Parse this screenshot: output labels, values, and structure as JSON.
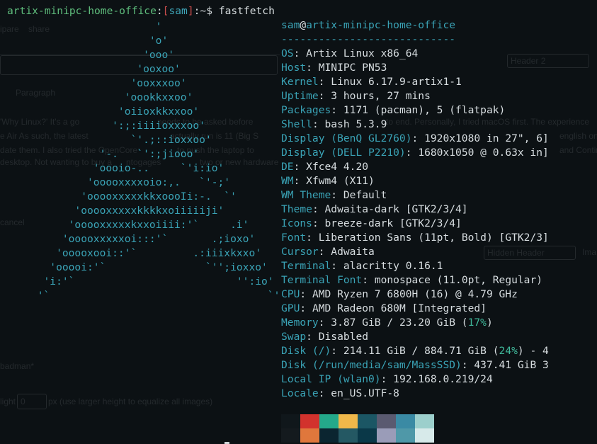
{
  "prompt": {
    "host": "artix-minipc-home-office",
    "colon": ":",
    "user": "sam",
    "suffix": ":~$ ",
    "command": "fastfetch"
  },
  "logo_lines": [
    "                         '",
    "                        'o'",
    "                       'ooo'",
    "                      'ooxoo'",
    "                     'ooxxxoo'",
    "                    'oookkxxoo'",
    "                   'oiioxkkxxoo'",
    "                  ':;:iiiioxxxoo'",
    "                     `'.;::ioxxoo'",
    "                '-.   `':;jiooo'",
    "               'oooio-..     `'i:io'",
    "              'ooooxxxxoio:,.   `'-;'",
    "             'ooooxxxxxkkxoooIi:-.  `'",
    "            'ooooxxxxxkkkkxoiiiiiji'",
    "           'ooooxxxxxkxxoiiii:'`     .i'",
    "          'ooooxxxxxoi:::'`       .;ioxo'",
    "         'ooooxooi::'`         .:iiixkxxo'",
    "        'ooooi:'`                `'';ioxxo'",
    "       'i:'`                          '':io'",
    "      '`                                   `'"
  ],
  "info": {
    "user": "sam",
    "at": "@",
    "host": "artix-minipc-home-office",
    "separator": "----------------------------",
    "rows": [
      {
        "key": "OS",
        "value": "Artix Linux x86_64"
      },
      {
        "key": "Host",
        "value": "MINIPC PN53"
      },
      {
        "key": "Kernel",
        "value": "Linux 6.17.9-artix1-1"
      },
      {
        "key": "Uptime",
        "value": "3 hours, 27 mins"
      },
      {
        "key": "Packages",
        "value": "1171 (pacman), 5 (flatpak)"
      },
      {
        "key": "Shell",
        "value": "bash 5.3.9"
      },
      {
        "key": "Display (BenQ GL2760)",
        "value": "1920x1080 in 27\", 6]"
      },
      {
        "key": "Display (DELL P2210)",
        "value": "1680x1050 @ 0.63x in]"
      },
      {
        "key": "DE",
        "value": "Xfce4 4.20"
      },
      {
        "key": "WM",
        "value": "Xfwm4 (X11)"
      },
      {
        "key": "WM Theme",
        "value": "Default"
      },
      {
        "key": "Theme",
        "value": "Adwaita-dark [GTK2/3/4]"
      },
      {
        "key": "Icons",
        "value": "breeze-dark [GTK2/3/4]"
      },
      {
        "key": "Font",
        "value": "Liberation Sans (11pt, Bold) [GTK2/3]"
      },
      {
        "key": "Cursor",
        "value": "Adwaita"
      },
      {
        "key": "Terminal",
        "value": "alacritty 0.16.1"
      },
      {
        "key": "Terminal Font",
        "value": "monospace (11.0pt, Regular)"
      },
      {
        "key": "CPU",
        "value": "AMD Ryzen 7 6800H (16) @ 4.79 GHz"
      },
      {
        "key": "GPU",
        "value": "AMD Radeon 680M [Integrated]"
      },
      {
        "key": "Memory",
        "value": "3.87 GiB / 23.20 GiB (",
        "pct": "17%",
        "tail": ")"
      },
      {
        "key": "Swap",
        "value": "Disabled"
      },
      {
        "key": "Disk (/)",
        "value": "214.11 GiB / 884.71 GiB (",
        "pct": "24%",
        "tail": ") - 4"
      },
      {
        "key": "Disk (/run/media/sam/MassSSD)",
        "value": "437.41 GiB 3"
      },
      {
        "key": "Local IP (wlan0)",
        "value": "192.168.0.219/24"
      },
      {
        "key": "Locale",
        "value": "en_US.UTF-8"
      }
    ]
  },
  "palette": {
    "top": [
      "#10171b",
      "#d2322d",
      "#24a98a",
      "#f0b84a",
      "#1b5664",
      "#5a5a70",
      "#3a8aa4",
      "#9ccfcc"
    ],
    "bottom": [
      "#141a1e",
      "#e0773c",
      "#0b2530",
      "#245863",
      "#0a3848",
      "#9a9cb8",
      "#4f98a8",
      "#d7eaea"
    ]
  },
  "ghost": {
    "header_select": "Header 2",
    "hidden_header_select": "Hidden Header",
    "paragraph_select": "Paragraph",
    "text1": "'Why Linux?' It's a go",
    "text2": "needs to be asked before",
    "text3": "to end. Personally, I tried macOS first. The experience",
    "text4": "e Air As such, the latest",
    "text5": "actually run is 11 (Big S",
    "text6": "english on the",
    "text7": "date them. I also tried the OpenCore",
    "text8": "to push the laptop to",
    "text9": "and Continuit",
    "text10": "desktop. Not wanting to buy a",
    "text11": "ntogages",
    "text12": "two or new hardware",
    "text13": "badman*",
    "text14": "light",
    "text15": "px (use larger height to equalize all images)",
    "text16": "Ima",
    "text17": "ipare",
    "text18": "share",
    "text19": "cancel",
    "light_input": "0"
  }
}
